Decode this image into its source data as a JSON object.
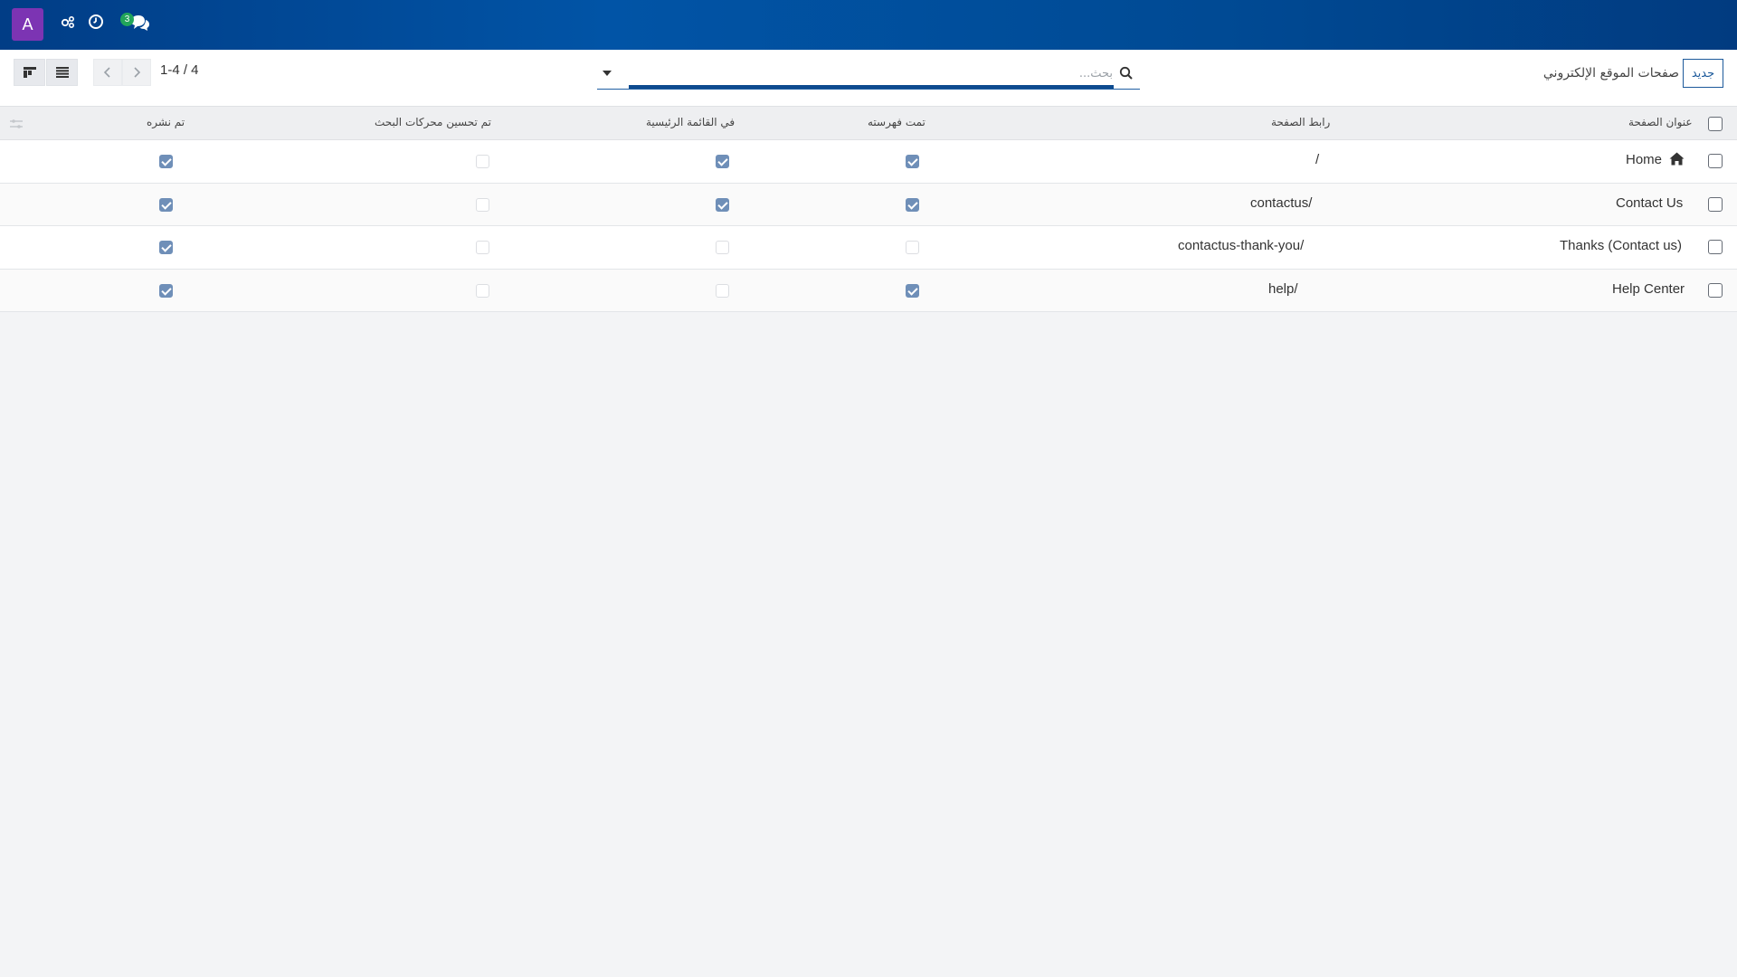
{
  "navbar": {
    "avatar_letter": "A",
    "chat_badge_count": "3",
    "icons": [
      "activity-icon",
      "clock-icon",
      "chat-icon"
    ],
    "gradient_colors": [
      "#013d86",
      "#0154a6",
      "#004a94"
    ],
    "avatar_color": "#7c34b3",
    "badge_color": "#22a55a"
  },
  "control_panel": {
    "breadcrumb": "صفحات الموقع الإلكتروني",
    "new_button_label": "جديد",
    "search_placeholder": "بحث...",
    "pager_value": "1-4 / 4",
    "view_buttons": [
      "kanban-view-icon",
      "list-view-icon"
    ]
  },
  "table": {
    "headers": {
      "title": "عنوان الصفحة",
      "url": "رابط الصفحة",
      "indexed": "تمت فهرسته",
      "in_menu": "في القائمة الرئيسية",
      "seo": "تم تحسين محركات البحث",
      "published": "تم نشره"
    },
    "rows": [
      {
        "title": "Home",
        "url": "/",
        "indexed": true,
        "in_menu": true,
        "seo": false,
        "published": true,
        "home_icon": true
      },
      {
        "title": "Contact Us",
        "url": "/contactus",
        "indexed": true,
        "in_menu": true,
        "seo": false,
        "published": true
      },
      {
        "title": "Thanks (Contact us)",
        "url": "/contactus-thank-you",
        "indexed": false,
        "in_menu": false,
        "seo": false,
        "published": true
      },
      {
        "title": "Help Center",
        "url": "/help",
        "indexed": true,
        "in_menu": false,
        "seo": false,
        "published": true
      }
    ]
  }
}
